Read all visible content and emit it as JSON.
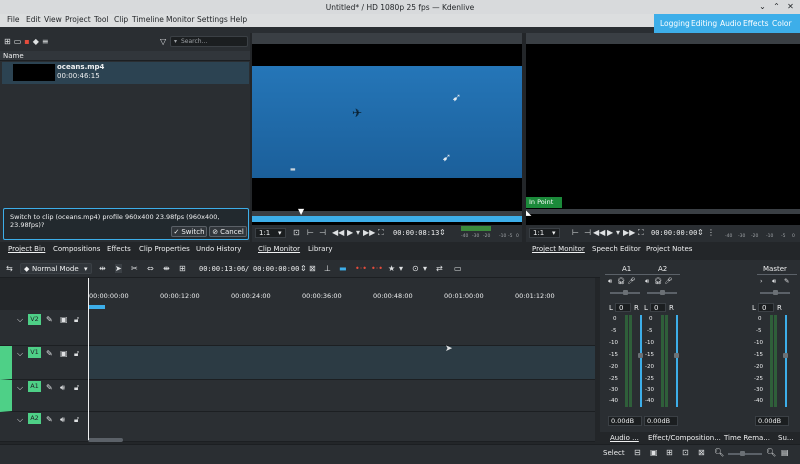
{
  "window": {
    "title": "Untitled* / HD 1080p 25 fps — Kdenlive"
  },
  "menu": [
    "File",
    "Edit",
    "View",
    "Project",
    "Tool",
    "Clip",
    "Timeline",
    "Monitor",
    "Settings",
    "Help"
  ],
  "layouts": [
    "Logging",
    "Editing",
    "Audio",
    "Effects",
    "Color"
  ],
  "bin": {
    "search_placeholder": "Search...",
    "column_name": "Name",
    "clip": {
      "name": "oceans.mp4",
      "duration": "00:00:46:15"
    },
    "message": "Switch to clip (oceans.mp4) profile 960x400 23.98fps (960x400, 23.98fps)?",
    "switch_label": "Switch",
    "cancel_label": "Cancel",
    "tabs": [
      "Project Bin",
      "Compositions",
      "Effects",
      "Clip Properties",
      "Undo History"
    ]
  },
  "clip_monitor": {
    "zoom": "1:1",
    "timecode": "00:00:08:13",
    "meter_labels": [
      "-40",
      "-30",
      "-20",
      "-10",
      "-5",
      "0"
    ],
    "tabs": [
      "Clip Monitor",
      "Library"
    ]
  },
  "project_monitor": {
    "in_point": "In Point",
    "zoom": "1:1",
    "timecode": "00:00:00:00",
    "meter_labels": [
      "-40",
      "-30",
      "-20",
      "-10",
      "-5",
      "0"
    ],
    "tabs": [
      "Project Monitor",
      "Speech Editor",
      "Project Notes"
    ]
  },
  "timeline": {
    "mode": "Normal Mode",
    "position": "00:00:13:06",
    "duration": "00:00:00:00",
    "ruler": [
      "00:00:00:00",
      "00:00:12:00",
      "00:00:24:00",
      "00:00:36:00",
      "00:00:48:00",
      "00:01:00:00",
      "00:01:12:00"
    ],
    "tracks": [
      "V2",
      "V1",
      "A1",
      "A2"
    ]
  },
  "mixer": {
    "channels": [
      "A1",
      "A2"
    ],
    "master": "Master",
    "lr": [
      "L",
      "R"
    ],
    "zero": "0",
    "scale": [
      "0",
      "-5",
      "-10",
      "-15",
      "-20",
      "-25",
      "-30",
      "-40"
    ],
    "db": "0.00dB",
    "tabs": [
      "Audio ...",
      "Effect/Composition...",
      "Time Rema...",
      "Su..."
    ]
  },
  "status": {
    "select": "Select"
  },
  "colors": {
    "accent": "#3daee9",
    "track_tag": "#4ed087",
    "bg": "#232629"
  }
}
